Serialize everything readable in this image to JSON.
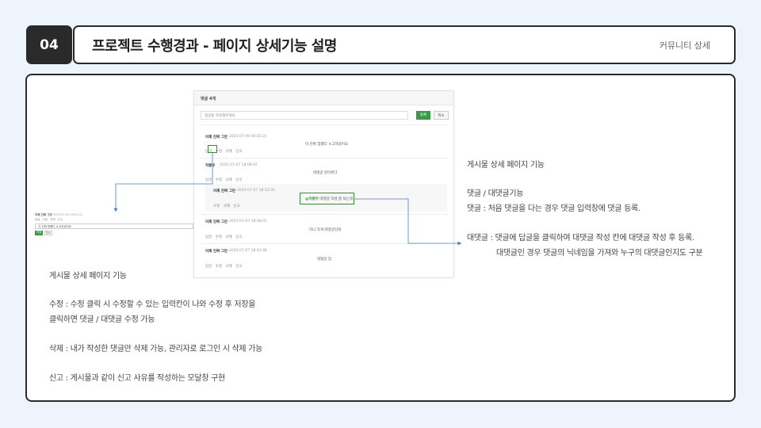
{
  "header": {
    "number": "04",
    "title": "프로젝트 수행경과 - 페이지 상세기능 설명",
    "section": "커뮤니티 상세"
  },
  "screenshot": {
    "header": "댓글 4개",
    "input_placeholder": "댓글을 작성해주세요",
    "register_label": "등록",
    "cancel_label": "취소",
    "comments": [
      {
        "author": "이제 진짜 그만",
        "date": "2025-07-09 09:03:21",
        "body": "이 진짜 힘쨌다 ㅎ고하셨어요",
        "actions": "답글  수정  삭제  신고"
      },
      {
        "author": "허릉우",
        "date": "2025-07-07 18:08:02",
        "body": "대댓글 달아본다",
        "actions": "답글  수정  삭제  신고"
      },
      {
        "author": "이제 진짜 그만",
        "date": "2025-07-07 18:22:35",
        "tag": "@허릉우",
        "body": "대댓글 작성 잘 되는데",
        "actions": "수정  삭제  신고"
      },
      {
        "author": "이제 진짜 그만",
        "date": "2025-07-07 18:08:01",
        "body": "하니 작게 대댓글인데",
        "actions": "답글  수정  삭제  신고"
      },
      {
        "author": "이제 진짜 그만",
        "date": "2025-07-07 18:03:48",
        "body": "대댓글 암",
        "actions": "답글  수정  삭제  신고"
      }
    ],
    "edit_highlight": "수정"
  },
  "small_shot": {
    "author": "이제 진짜 그만",
    "date": "2025-07-09 09:03:21",
    "actions": "답글  수정  삭제  신고",
    "input_value": "이 진짜 힘쨌다 ㅎ고하셨어요",
    "save_label": "저장",
    "cancel_label": "취소"
  },
  "right_notes": {
    "title": "게시물 상세 페이지 기능",
    "feature": "댓글 / 대댓글기능",
    "comment": "댓글 : 처음 댓글을 다는 경우 댓글 입력창에 댓글 등록.",
    "reply1": "대댓글 : 댓글에 답글을 클릭하여 대댓글 작성 칸에 대댓글 작성 후 등록.",
    "reply2": "대댓글인 경우 댓글의 닉네임을 가져와 누구의 대댓글인지도 구분"
  },
  "left_notes": {
    "title": "게시물 상세 페이지 기능",
    "edit1": "수정 : 수정 클릭 시 수정할 수 있는 입력칸이 나와 수정 후 저장을",
    "edit2": "클릭하면 댓글 / 대댓글 수정 가능",
    "delete": "삭제 : 내가 작성한 댓글만 삭제 가능, 관리자로 로그인 시 삭제 가능",
    "report": "신고 : 게시물과 같이 신고 사유를 작성하는 모달창 구현"
  },
  "colors": {
    "accent_dark": "#2a2a2a",
    "highlight_green": "#3a8a3a",
    "arrow_blue": "#4a7ec0"
  }
}
